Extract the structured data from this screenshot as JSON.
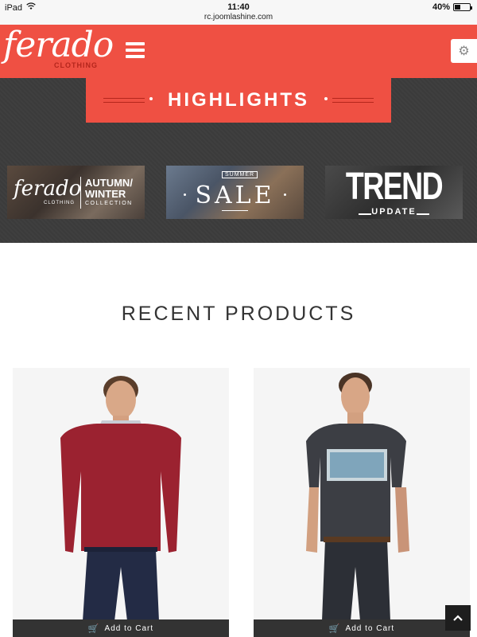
{
  "status_bar": {
    "device": "iPad",
    "time": "11:40",
    "url": "rc.joomlashine.com",
    "battery": "40%",
    "battery_level": 0.4
  },
  "header": {
    "logo_main": "ferado",
    "logo_sub": "CLOTHING",
    "brand_color": "#ef5043"
  },
  "highlights": {
    "title": "HIGHLIGHTS",
    "banners": [
      {
        "logo": "ferado",
        "logo_sub": "CLOTHING",
        "line1": "AUTUMN/",
        "line2": "WINTER",
        "line3": "COLLECTION"
      },
      {
        "small": "SUMMER",
        "main": "SALE"
      },
      {
        "main": "TREND",
        "sub": "UPDATE"
      }
    ]
  },
  "recent": {
    "title": "RECENT PRODUCTS",
    "products": [
      {
        "cart_label": "Add to Cart"
      },
      {
        "cart_label": "Add to Cart"
      }
    ]
  }
}
